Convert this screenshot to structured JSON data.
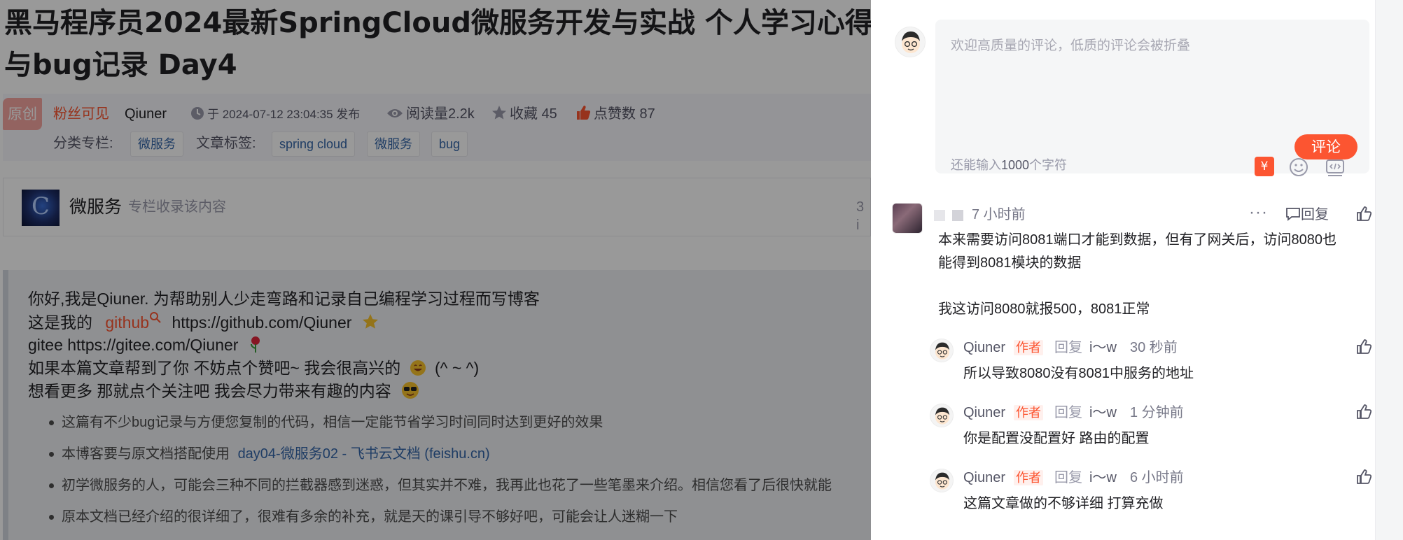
{
  "article": {
    "title_line1": "黑马程序员2024最新SpringCloud微服务开发与实战 个人学习心得",
    "title_line2": "与bug记录 Day4",
    "badge": "原创",
    "visibility": "粉丝可见",
    "author": "Qiuner",
    "published": "于 2024-07-12 23:04:35 发布",
    "reads": "阅读量2.2k",
    "favorites": "收藏 45",
    "likes": "点赞数 87",
    "category_label": "分类专栏:",
    "category": "微服务",
    "tags_label": "文章标签:",
    "tags": [
      "spring cloud",
      "微服务",
      "bug"
    ],
    "column": {
      "name": "微服务",
      "desc": "专栏收录该内容",
      "count": "3 i"
    },
    "intro": {
      "line1": "你好,我是Qiuner. 为帮助别人少走弯路和记录自己编程学习过程而写博客",
      "line2_prefix": "这是我的",
      "line2_link": "github",
      "line2_url": "https://github.com/Qiuner",
      "line3": "gitee https://gitee.com/Qiuner",
      "line4": "如果本篇文章帮到了你 不妨点个赞吧~ 我会很高兴的",
      "line4_suffix": "(^ ~ ^)",
      "line5": "想看更多 那就点个关注吧 我会尽力带来有趣的内容"
    },
    "bullets": [
      "这篇有不少bug记录与方便您复制的代码，相信一定能节省学习时间同时达到更好的效果",
      "初学微服务的人，可能会三种不同的拦截器感到迷惑，但其实并不难，我再此也花了一些笔墨来介绍。相信您看了后很快就能",
      "原本文档已经介绍的很详细了，很难有多余的补充，就是天的课引导不够好吧，可能会让人迷糊一下"
    ],
    "bullet2_prefix": "本博客要与原文档搭配使用",
    "bullet2_link": "day04-微服务02 - 飞书云文档 (feishu.cn)"
  },
  "comments_panel": {
    "editor": {
      "placeholder": "欢迎高质量的评论，低质的评论会被折叠",
      "remaining_prefix": "还能输入",
      "remaining_count": "1000",
      "remaining_suffix": "个字符",
      "yen_icon": "¥",
      "submit_label": "评论"
    },
    "main_comment": {
      "time": "7 小时前",
      "more": "···",
      "reply_label": "回复",
      "text_line1": "本来需要访问8081端口才能到数据，但有了网关后，访问8080也",
      "text_line2": "能得到8081模块的数据",
      "text_line3": "我这访问8080就报500，8081正常"
    },
    "replies": [
      {
        "author": "Qiuner",
        "tag": "作者",
        "reply_word": "回复",
        "reply_to": "i～w",
        "time": "30 秒前",
        "text": "所以导致8080没有8081中服务的地址"
      },
      {
        "author": "Qiuner",
        "tag": "作者",
        "reply_word": "回复",
        "reply_to": "i～w",
        "time": "1 分钟前",
        "text": "你是配置没配置好 路由的配置"
      },
      {
        "author": "Qiuner",
        "tag": "作者",
        "reply_word": "回复",
        "reply_to": "i～w",
        "time": "6 小时前",
        "text": "这篇文章做的不够详细 打算充做"
      }
    ]
  },
  "colors": {
    "accent": "#fc5531",
    "link": "#3566a8",
    "overlay": "rgba(0,0,0,0.40)"
  }
}
